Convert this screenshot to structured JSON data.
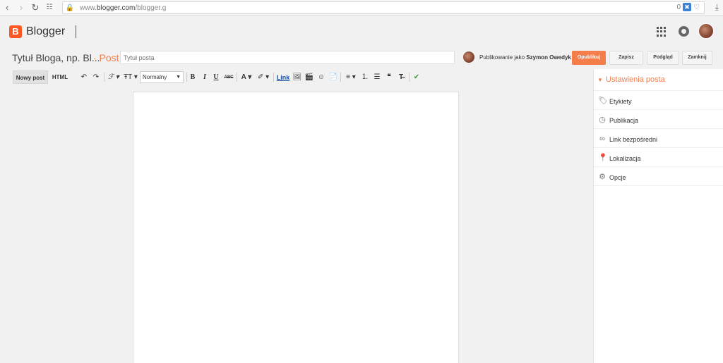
{
  "browser": {
    "url_prefix": "www.",
    "url_domain": "blogger.com",
    "url_path": "/blogger.g",
    "ext_count": "0"
  },
  "app": {
    "logo_letter": "B",
    "name": "Blogger"
  },
  "post": {
    "blog_title": "Tytuł Bloga, np. Bl...",
    "section": "· Post",
    "title_placeholder": "Tytuł posta",
    "publishing_as_prefix": "Publikowanie jako",
    "publishing_as_user": "Szymon Owedyk",
    "publish_label": "Opublikuj",
    "save_label": "Zapisz",
    "preview_label": "Podgląd",
    "close_label": "Zamknij"
  },
  "toolbar": {
    "mode_compose": "Nowy post",
    "mode_html": "HTML",
    "undo": "↶",
    "redo": "↷",
    "font_family": "ℱ ▾",
    "font_size": "ŦT ▾",
    "format_value": "Normalny",
    "bold": "B",
    "italic": "I",
    "underline": "U",
    "strike": "ABC",
    "text_color": "A ▾",
    "highlight": "✐ ▾",
    "link": "Link",
    "align": "≡ ▾",
    "numbered_list": "⒈",
    "bullet_list": "☰",
    "quote": "❝",
    "clear_format": "T̶"
  },
  "sidebar": {
    "title": "Ustawienia posta",
    "items": [
      {
        "label": "Etykiety",
        "icon": "tag-icon"
      },
      {
        "label": "Publikacja",
        "icon": "clock-icon"
      },
      {
        "label": "Link bezpośredni",
        "icon": "link-icon"
      },
      {
        "label": "Lokalizacja",
        "icon": "pin-icon"
      },
      {
        "label": "Opcje",
        "icon": "gear-icon"
      }
    ]
  },
  "colors": {
    "accent": "#f57d4a",
    "brand": "#ff5722"
  }
}
